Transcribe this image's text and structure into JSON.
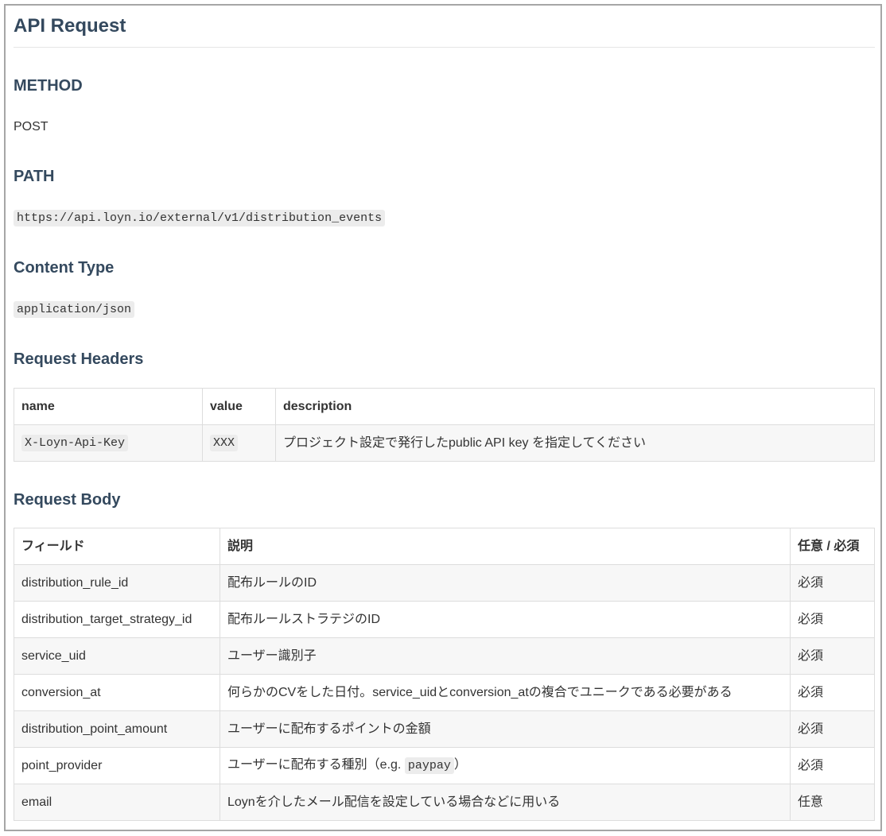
{
  "theme": {
    "heading_color": "#34495e",
    "text_color": "#333333",
    "frame_border": "#a6a6a6",
    "divider": "#e6e6e6",
    "table_border": "#dddddd",
    "stripe": "#f7f7f7",
    "code_bg": "#ececec"
  },
  "title": "API Request",
  "method": {
    "heading": "METHOD",
    "value": "POST"
  },
  "path": {
    "heading": "PATH",
    "value": "https://api.loyn.io/external/v1/distribution_events"
  },
  "content_type": {
    "heading": "Content Type",
    "value": "application/json"
  },
  "request_headers": {
    "heading": "Request Headers",
    "columns": {
      "name": "name",
      "value": "value",
      "description": "description"
    },
    "rows": [
      {
        "name": "X-Loyn-Api-Key",
        "value": "XXX",
        "description": "プロジェクト設定で発行したpublic API key を指定してください"
      }
    ]
  },
  "request_body": {
    "heading": "Request Body",
    "columns": {
      "field": "フィールド",
      "description": "説明",
      "requirement": "任意 / 必須"
    },
    "rows": [
      {
        "field": "distribution_rule_id",
        "description": "配布ルールのID",
        "requirement": "必須"
      },
      {
        "field": "distribution_target_strategy_id",
        "description": "配布ルールストラテジのID",
        "requirement": "必須"
      },
      {
        "field": "service_uid",
        "description": "ユーザー識別子",
        "requirement": "必須"
      },
      {
        "field": "conversion_at",
        "description": "何らかのCVをした日付。service_uidとconversion_atの複合でユニークである必要がある",
        "requirement": "必須"
      },
      {
        "field": "distribution_point_amount",
        "description": "ユーザーに配布するポイントの金額",
        "requirement": "必須"
      },
      {
        "field": "point_provider",
        "description": "ユーザーに配布する種別（e.g. ",
        "description_code": "paypay",
        "description_after": "）",
        "requirement": "必須"
      },
      {
        "field": "email",
        "description": "Loynを介したメール配信を設定している場合などに用いる",
        "requirement": "任意"
      }
    ]
  }
}
